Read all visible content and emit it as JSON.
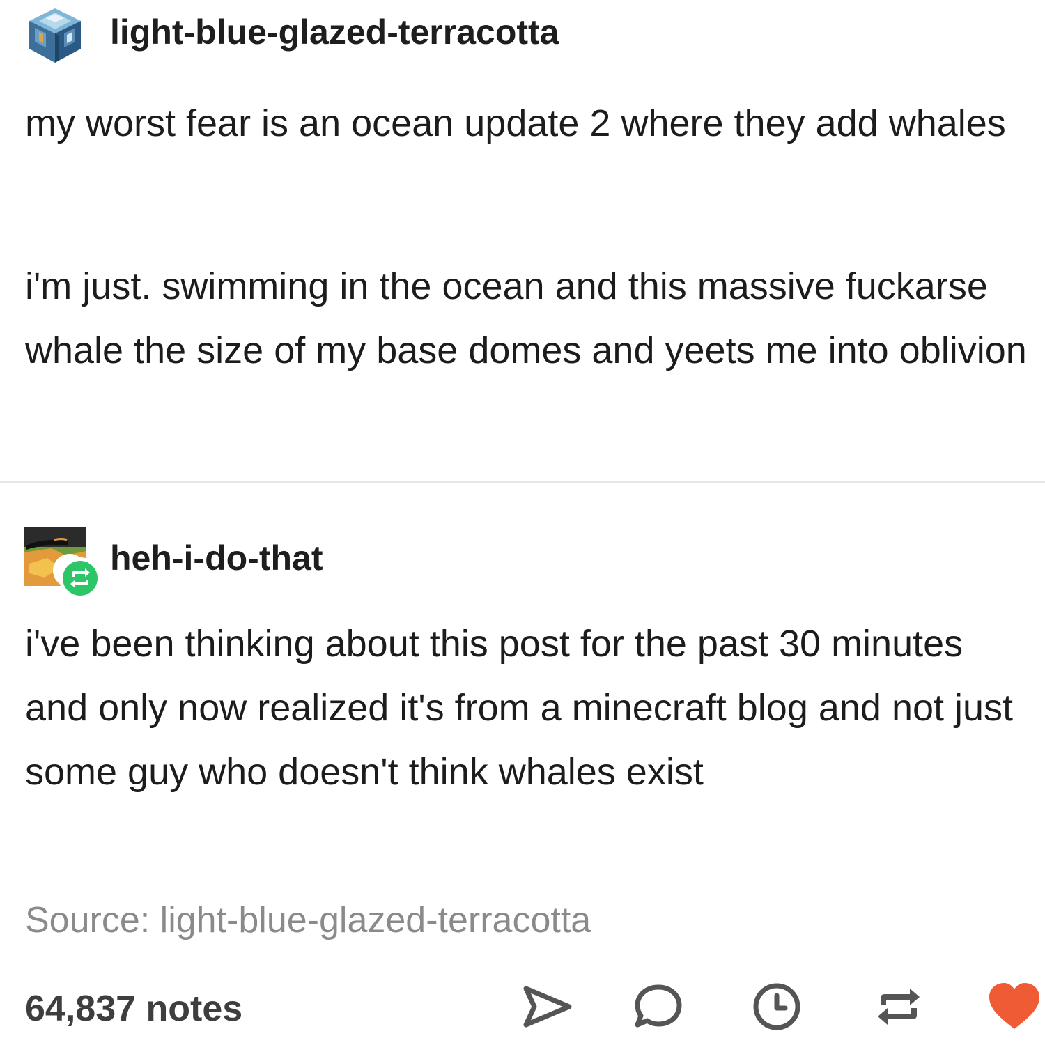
{
  "original_post": {
    "username": "light-blue-glazed-terracotta",
    "avatar_icon": "glazed-terracotta-block-icon",
    "paragraphs": [
      "my worst fear is an ocean update 2 where they add whales",
      "i'm just. swimming in the ocean and this massive fuckarse whale the size of my base domes and yeets me into oblivion"
    ]
  },
  "reblog": {
    "username": "heh-i-do-that",
    "avatar_icon": "reblog-avatar-icon",
    "reblog_badge_icon": "reblog-badge-icon",
    "paragraphs": [
      "i've been thinking about this post for the past 30 minutes and only now realized it's from a minecraft blog and not just some guy who doesn't think whales exist"
    ],
    "source_label": "Source: light-blue-glazed-terracotta"
  },
  "footer": {
    "notes": "64,837 notes",
    "actions": [
      {
        "icon": "share-icon"
      },
      {
        "icon": "reply-icon"
      },
      {
        "icon": "clock-icon"
      },
      {
        "icon": "reblog-icon"
      },
      {
        "icon": "heart-icon"
      }
    ]
  },
  "colors": {
    "text": "#1c1c1c",
    "source_text": "#8a8a8a",
    "reblog_badge": "#2cc568",
    "heart": "#ef5b34",
    "action_icon": "#555555",
    "divider": "#e6e6e6"
  }
}
